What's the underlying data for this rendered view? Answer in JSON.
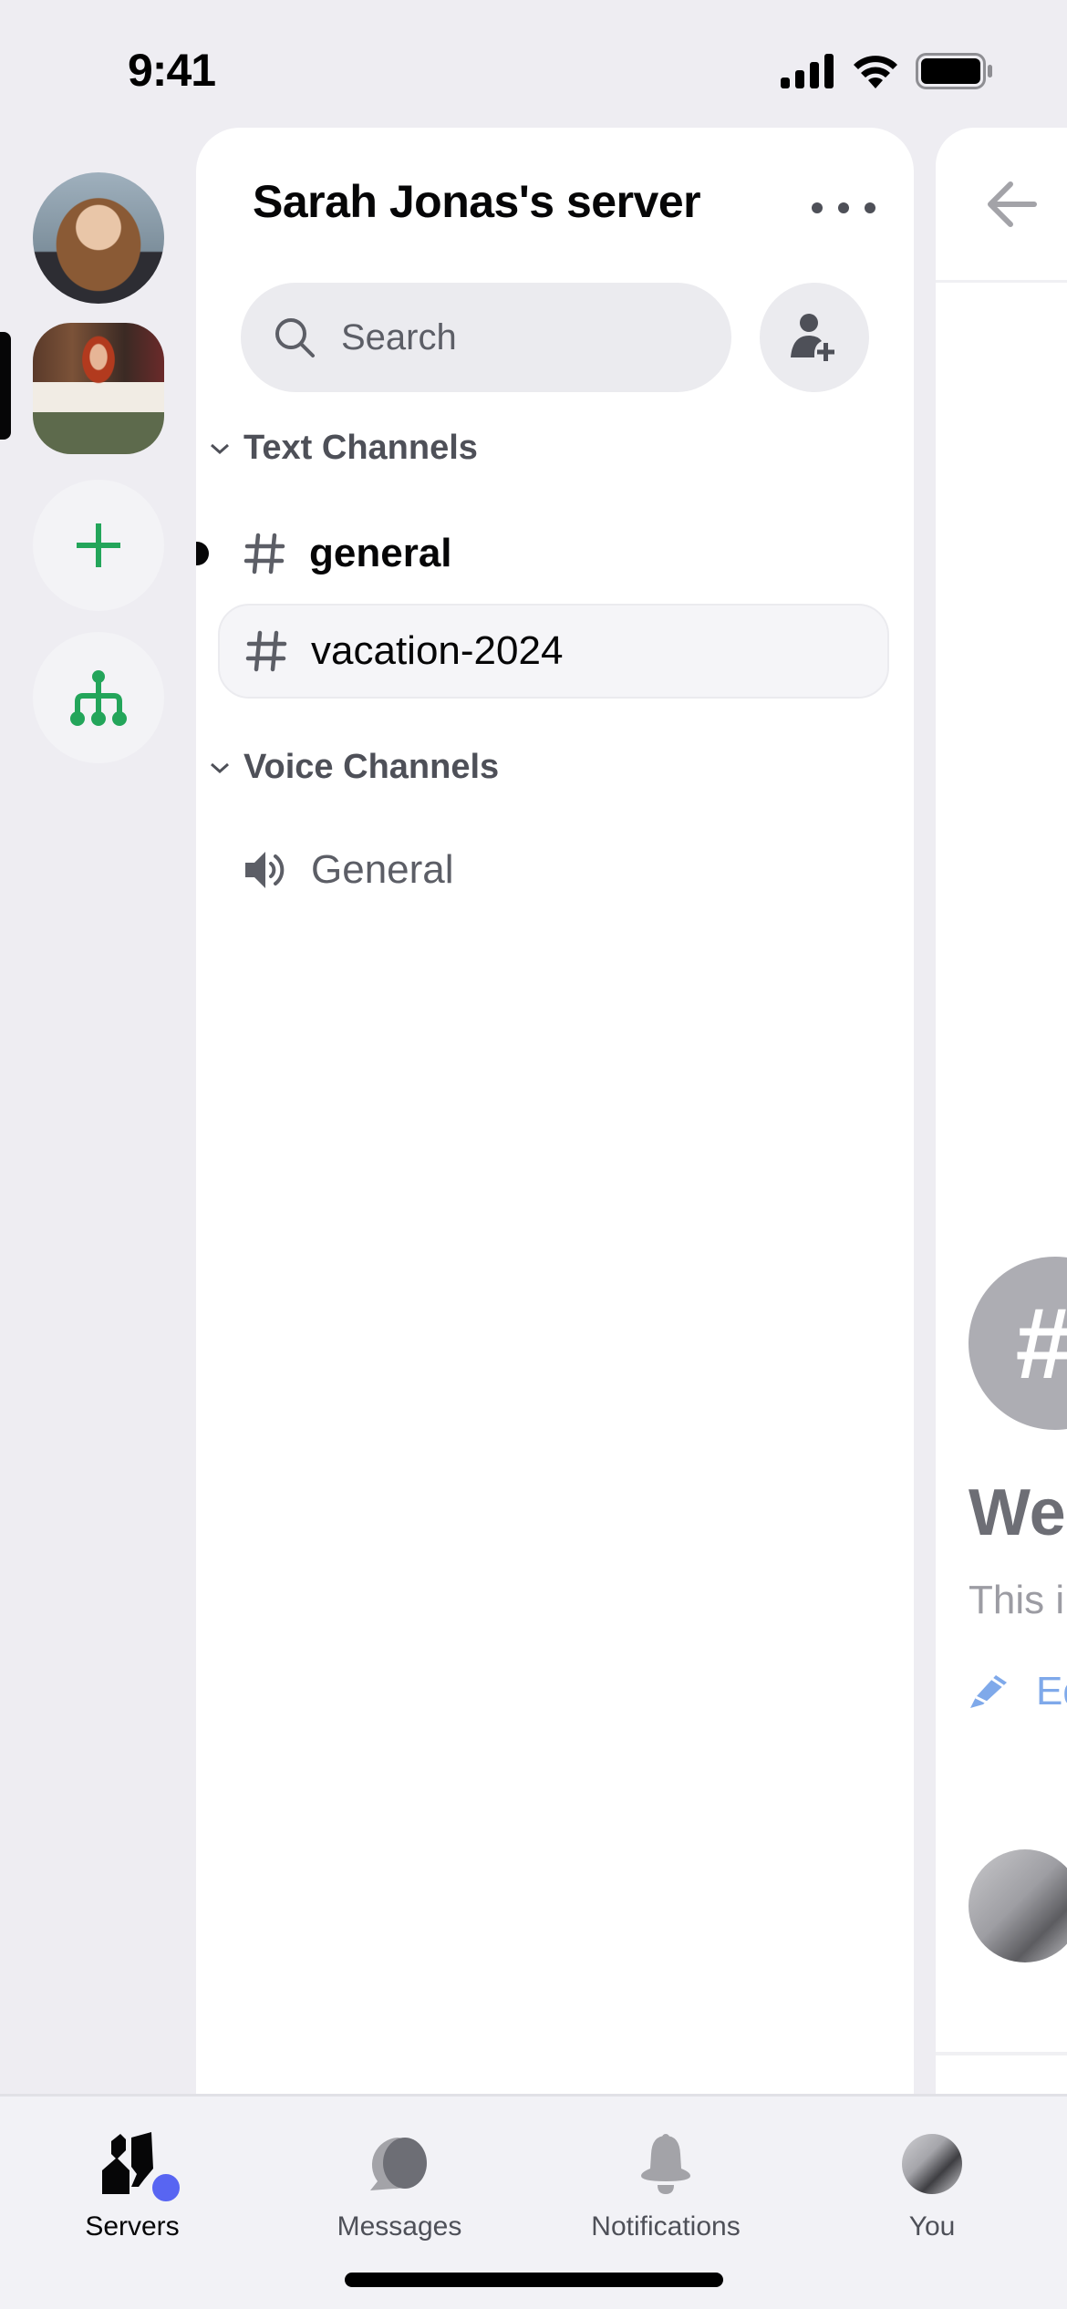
{
  "status_bar": {
    "time": "9:41",
    "icons": [
      "cellular-signal-icon",
      "wifi-icon",
      "battery-icon"
    ]
  },
  "server_rail": {
    "items": [
      {
        "type": "server",
        "name": "Sarah Jonas profile server",
        "shape": "circle",
        "selected": false
      },
      {
        "type": "server",
        "name": "Sarah Jonas's server",
        "shape": "squircle",
        "selected": true
      },
      {
        "type": "action",
        "icon": "plus-icon",
        "label": "Add a Server"
      },
      {
        "type": "action",
        "icon": "hub-tree-icon",
        "label": "Explore Discoverable Servers"
      }
    ],
    "action_color": "#23a55a"
  },
  "channel_panel": {
    "server_name": "Sarah Jonas's server",
    "more_icon": "ellipsis-icon",
    "search": {
      "placeholder": "Search",
      "value": ""
    },
    "invite_icon": "add-member-icon",
    "categories": [
      {
        "label": "Text Channels",
        "channels": [
          {
            "name": "general",
            "icon": "hash-icon",
            "unread": true,
            "selected": false
          },
          {
            "name": "vacation-2024",
            "icon": "hash-icon",
            "unread": false,
            "selected": true
          }
        ]
      },
      {
        "label": "Voice Channels",
        "channels": [
          {
            "name": "General",
            "icon": "speaker-icon",
            "unread": false,
            "selected": false
          }
        ]
      }
    ]
  },
  "chat_panel": {
    "back_icon": "arrow-left-icon",
    "welcome_icon": "#",
    "welcome_title_partial": "Wel",
    "welcome_subtitle_partial": "This i",
    "edit_link_partial": "Ed",
    "link_color": "#7fa9ea"
  },
  "tab_bar": {
    "tabs": [
      {
        "label": "Servers",
        "icon": "servers-icon",
        "active": true,
        "badge": true
      },
      {
        "label": "Messages",
        "icon": "messages-icon",
        "active": false
      },
      {
        "label": "Notifications",
        "icon": "bell-icon",
        "active": false
      },
      {
        "label": "You",
        "icon": "profile-avatar",
        "active": false
      }
    ],
    "badge_color": "#5865f2"
  }
}
